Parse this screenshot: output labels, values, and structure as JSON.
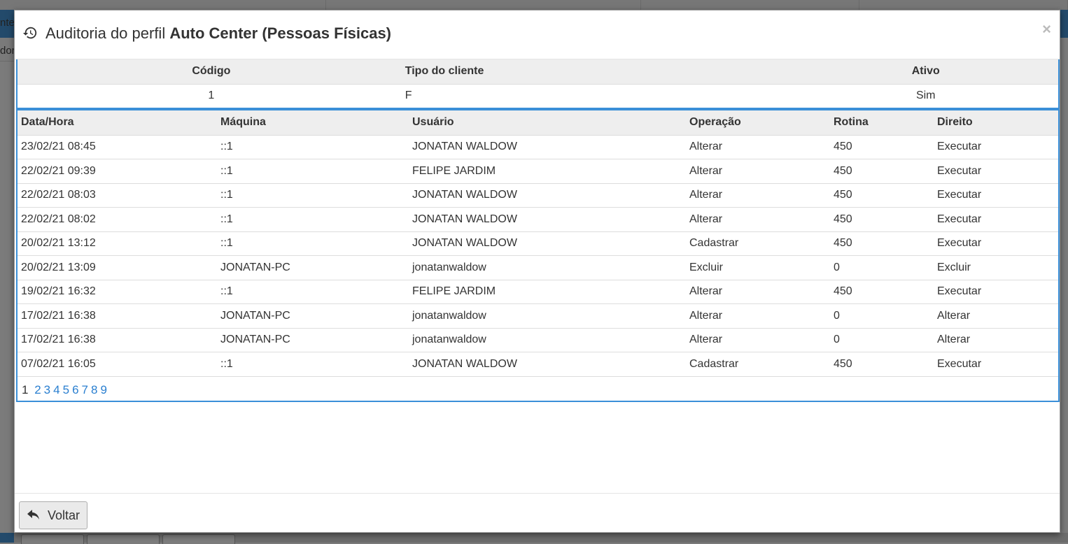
{
  "modal": {
    "title_prefix": "Auditoria do perfil",
    "title_bold": "Auto Center (Pessoas Físicas)",
    "close_label": "×"
  },
  "profile": {
    "headers": [
      "Código",
      "Tipo do cliente",
      "Ativo"
    ],
    "values": [
      "1",
      "F",
      "Sim"
    ]
  },
  "audit": {
    "headers": [
      "Data/Hora",
      "Máquina",
      "Usuário",
      "Operação",
      "Rotina",
      "Direito"
    ],
    "rows": [
      [
        "23/02/21 08:45",
        "::1",
        "JONATAN WALDOW",
        "Alterar",
        "450",
        "Executar"
      ],
      [
        "22/02/21 09:39",
        "::1",
        "FELIPE JARDIM",
        "Alterar",
        "450",
        "Executar"
      ],
      [
        "22/02/21 08:03",
        "::1",
        "JONATAN WALDOW",
        "Alterar",
        "450",
        "Executar"
      ],
      [
        "22/02/21 08:02",
        "::1",
        "JONATAN WALDOW",
        "Alterar",
        "450",
        "Executar"
      ],
      [
        "20/02/21 13:12",
        "::1",
        "JONATAN WALDOW",
        "Cadastrar",
        "450",
        "Executar"
      ],
      [
        "20/02/21 13:09",
        "JONATAN-PC",
        "jonatanwaldow",
        "Excluir",
        "0",
        "Excluir"
      ],
      [
        "19/02/21 16:32",
        "::1",
        "FELIPE JARDIM",
        "Alterar",
        "450",
        "Executar"
      ],
      [
        "17/02/21 16:38",
        "JONATAN-PC",
        "jonatanwaldow",
        "Alterar",
        "0",
        "Alterar"
      ],
      [
        "17/02/21 16:38",
        "JONATAN-PC",
        "jonatanwaldow",
        "Alterar",
        "0",
        "Alterar"
      ],
      [
        "07/02/21 16:05",
        "::1",
        "JONATAN WALDOW",
        "Cadastrar",
        "450",
        "Executar"
      ]
    ]
  },
  "pagination": {
    "current": "1",
    "pages": [
      "2",
      "3",
      "4",
      "5",
      "6",
      "7",
      "8",
      "9"
    ]
  },
  "footer": {
    "back_label": "Voltar"
  },
  "background": {
    "left_fragment_1": "nter",
    "left_fragment_2": "dor"
  },
  "colors": {
    "accent_border": "#3a8fd8",
    "link": "#2a7fd0",
    "header_bg": "#eeeeee",
    "overlay": "#7b7b7b"
  }
}
